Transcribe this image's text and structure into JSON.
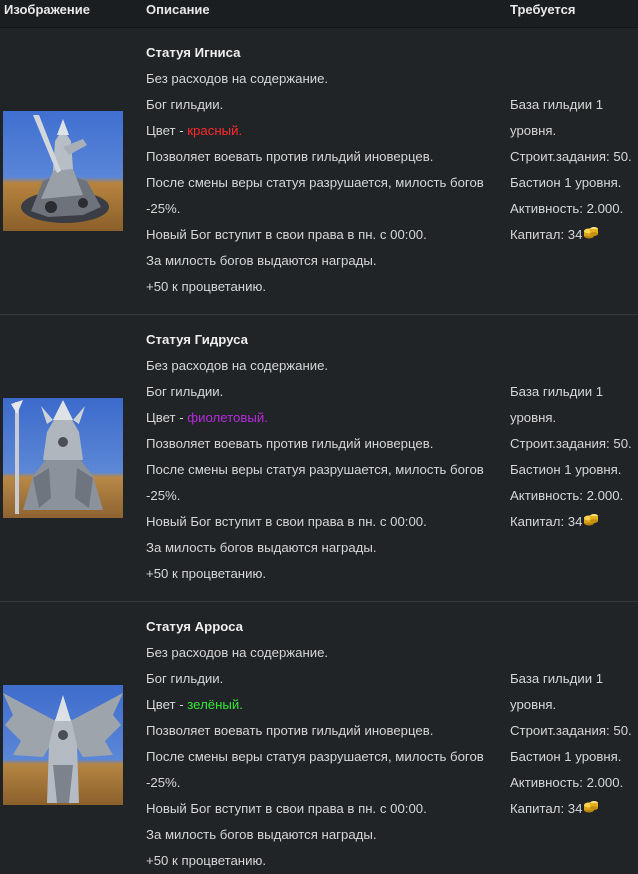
{
  "header": {
    "image": "Изображение",
    "description": "Описание",
    "requires": "Требуется"
  },
  "rows": [
    {
      "title": "Статуя Игниса",
      "l1": "Без расходов на содержание.",
      "l2": "Бог гильдии.",
      "color_prefix": "Цвет - ",
      "color_name": "красный.",
      "color_hex": "#ff2a2a",
      "l4": "Позволяет воевать против гильдий иноверцев.",
      "l5": "После смены веры статуя разрушается, милость богов",
      "l6": "-25%.",
      "l7": "Новый Бог вступит в свои права в пн. с 00:00.",
      "l8": "За милость богов выдаются награды.",
      "l9": "+50 к процветанию.",
      "r1": "База гильдии 1",
      "r2": "уровня.",
      "r3": "Строит.задания: 50.",
      "r4": "Бастион 1 уровня.",
      "r5": "Активность: 2.000.",
      "r6": "Капитал: 34",
      "icon": "gold-coins-icon"
    },
    {
      "title": "Статуя Гидруса",
      "l1": "Без расходов на содержание.",
      "l2": "Бог гильдии.",
      "color_prefix": "Цвет - ",
      "color_name": "фиолетовый.",
      "color_hex": "#b52bd9",
      "l4": "Позволяет воевать против гильдий иноверцев.",
      "l5": "После смены веры статуя разрушается, милость богов",
      "l6": "-25%.",
      "l7": "Новый Бог вступит в свои права в пн. с 00:00.",
      "l8": "За милость богов выдаются награды.",
      "l9": "+50 к процветанию.",
      "r1": "База гильдии 1",
      "r2": "уровня.",
      "r3": "Строит.задания: 50.",
      "r4": "Бастион 1 уровня.",
      "r5": "Активность: 2.000.",
      "r6": "Капитал: 34",
      "icon": "gold-coins-icon"
    },
    {
      "title": "Статуя Арроса",
      "l1": "Без расходов на содержание.",
      "l2": "Бог гильдии.",
      "color_prefix": "Цвет - ",
      "color_name": "зелёный.",
      "color_hex": "#35e635",
      "l4": "Позволяет воевать против гильдий иноверцев.",
      "l5": "После смены веры статуя разрушается, милость богов",
      "l6": "-25%.",
      "l7": "Новый Бог вступит в свои права в пн. с 00:00.",
      "l8": "За милость богов выдаются награды.",
      "l9": "+50 к процветанию.",
      "r1": "База гильдии 1",
      "r2": "уровня.",
      "r3": "Строит.задания: 50.",
      "r4": "Бастион 1 уровня.",
      "r5": "Активность: 2.000.",
      "r6": "Капитал: 34",
      "icon": "gold-coins-icon"
    }
  ],
  "colors": {
    "background": "#202427",
    "header_bg": "#1b1e21",
    "divider": "#34383c",
    "text": "#d6d6d6"
  }
}
